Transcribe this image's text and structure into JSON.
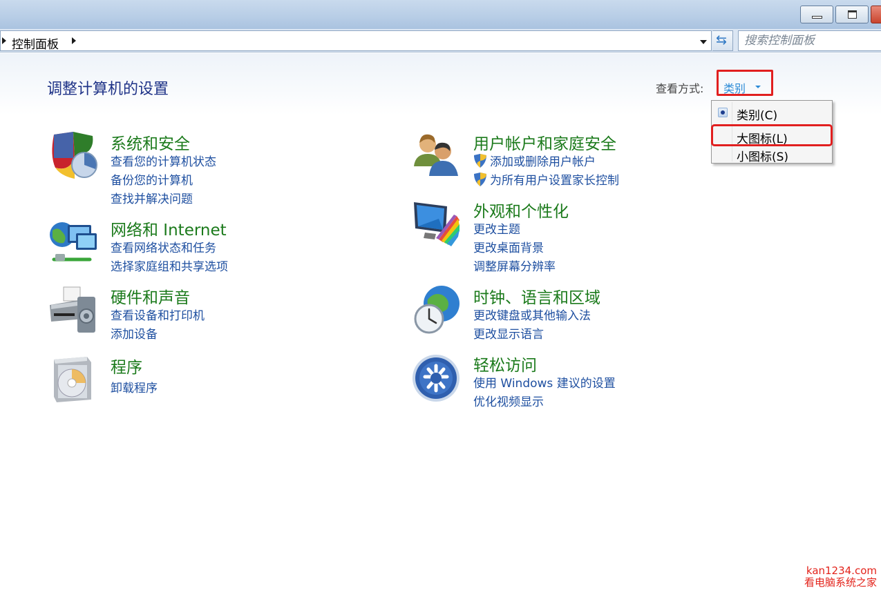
{
  "window": {
    "min_icon": "minimize-icon",
    "max_icon": "maximize-icon",
    "close_icon": "close-icon"
  },
  "address": {
    "breadcrumb": "控制面板",
    "search_placeholder": "搜索控制面板"
  },
  "header": {
    "title": "调整计算机的设置",
    "view_by_label": "查看方式:",
    "view_by_value": "类别"
  },
  "view_menu": {
    "items": [
      {
        "label": "类别(C)",
        "selected": true
      },
      {
        "label": "大图标(L)",
        "selected": false
      },
      {
        "label": "小图标(S)",
        "selected": false
      }
    ]
  },
  "categories": [
    {
      "title": "系统和安全",
      "icon": "shield-security-icon",
      "links": [
        "查看您的计算机状态",
        "备份您的计算机",
        "查找并解决问题"
      ]
    },
    {
      "title": "网络和 Internet",
      "icon": "network-globe-icon",
      "links": [
        "查看网络状态和任务",
        "选择家庭组和共享选项"
      ]
    },
    {
      "title": "硬件和声音",
      "icon": "printer-speaker-icon",
      "links": [
        "查看设备和打印机",
        "添加设备"
      ]
    },
    {
      "title": "程序",
      "icon": "programs-disc-icon",
      "links": [
        "卸载程序"
      ]
    },
    {
      "title": "用户帐户和家庭安全",
      "icon": "users-icon",
      "links": [
        "添加或删除用户帐户",
        "为所有用户设置家长控制"
      ]
    },
    {
      "title": "外观和个性化",
      "icon": "monitor-palette-icon",
      "links": [
        "更改主题",
        "更改桌面背景",
        "调整屏幕分辨率"
      ]
    },
    {
      "title": "时钟、语言和区域",
      "icon": "clock-globe-icon",
      "links": [
        "更改键盘或其他输入法",
        "更改显示语言"
      ]
    },
    {
      "title": "轻松访问",
      "icon": "ease-of-access-icon",
      "links": [
        "使用 Windows 建议的设置",
        "优化视频显示"
      ]
    }
  ],
  "watermark": {
    "line1": "kan1234.com",
    "line2": "看电脑系统之家"
  },
  "colors": {
    "category_title": "#1b7a1b",
    "link": "#1e4fa0",
    "highlight_box": "#e11f1f",
    "page_title": "#1e3287"
  }
}
